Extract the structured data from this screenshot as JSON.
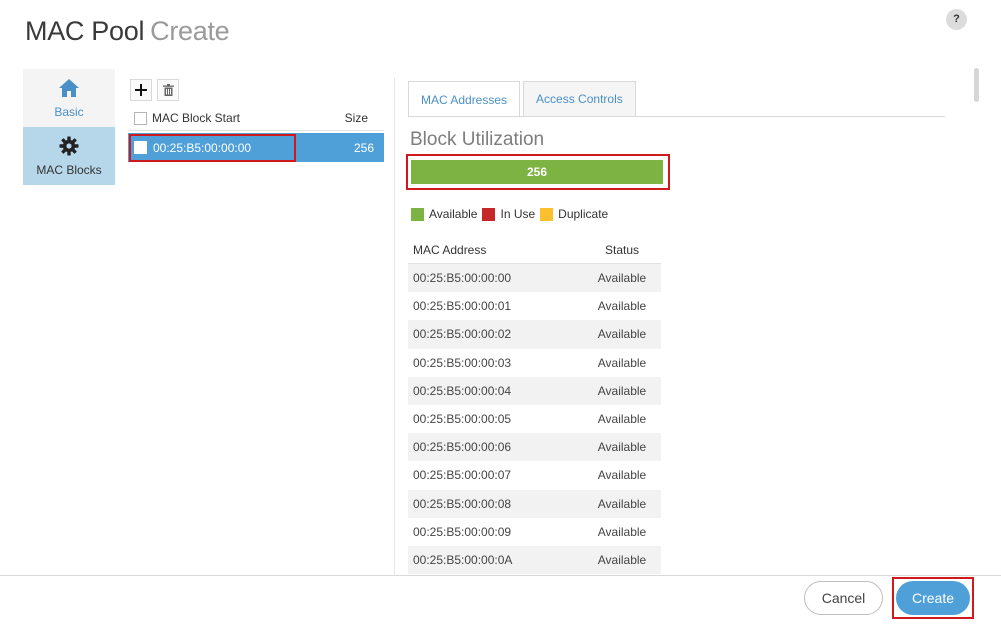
{
  "header": {
    "title": "MAC Pool",
    "subtitle": "Create",
    "help_label": "?"
  },
  "nav": {
    "items": [
      {
        "label": "Basic",
        "icon": "home-icon"
      },
      {
        "label": "MAC Blocks",
        "icon": "gear-icon"
      }
    ]
  },
  "blocks": {
    "columns": {
      "start": "MAC Block Start",
      "size": "Size"
    },
    "rows": [
      {
        "start": "00:25:B5:00:00:00",
        "size": "256"
      }
    ]
  },
  "tabs": [
    {
      "label": "MAC Addresses"
    },
    {
      "label": "Access Controls"
    }
  ],
  "utilization": {
    "title": "Block Utilization",
    "value_label": "256",
    "available_fraction": 1.0,
    "legend": [
      {
        "label": "Available",
        "color": "#7cb342"
      },
      {
        "label": "In Use",
        "color": "#c62828"
      },
      {
        "label": "Duplicate",
        "color": "#fbc02d"
      }
    ]
  },
  "mac_table": {
    "columns": {
      "mac": "MAC Address",
      "status": "Status"
    },
    "rows": [
      {
        "mac": "00:25:B5:00:00:00",
        "status": "Available"
      },
      {
        "mac": "00:25:B5:00:00:01",
        "status": "Available"
      },
      {
        "mac": "00:25:B5:00:00:02",
        "status": "Available"
      },
      {
        "mac": "00:25:B5:00:00:03",
        "status": "Available"
      },
      {
        "mac": "00:25:B5:00:00:04",
        "status": "Available"
      },
      {
        "mac": "00:25:B5:00:00:05",
        "status": "Available"
      },
      {
        "mac": "00:25:B5:00:00:06",
        "status": "Available"
      },
      {
        "mac": "00:25:B5:00:00:07",
        "status": "Available"
      },
      {
        "mac": "00:25:B5:00:00:08",
        "status": "Available"
      },
      {
        "mac": "00:25:B5:00:00:09",
        "status": "Available"
      },
      {
        "mac": "00:25:B5:00:00:0A",
        "status": "Available"
      }
    ]
  },
  "footer": {
    "cancel_label": "Cancel",
    "create_label": "Create"
  }
}
